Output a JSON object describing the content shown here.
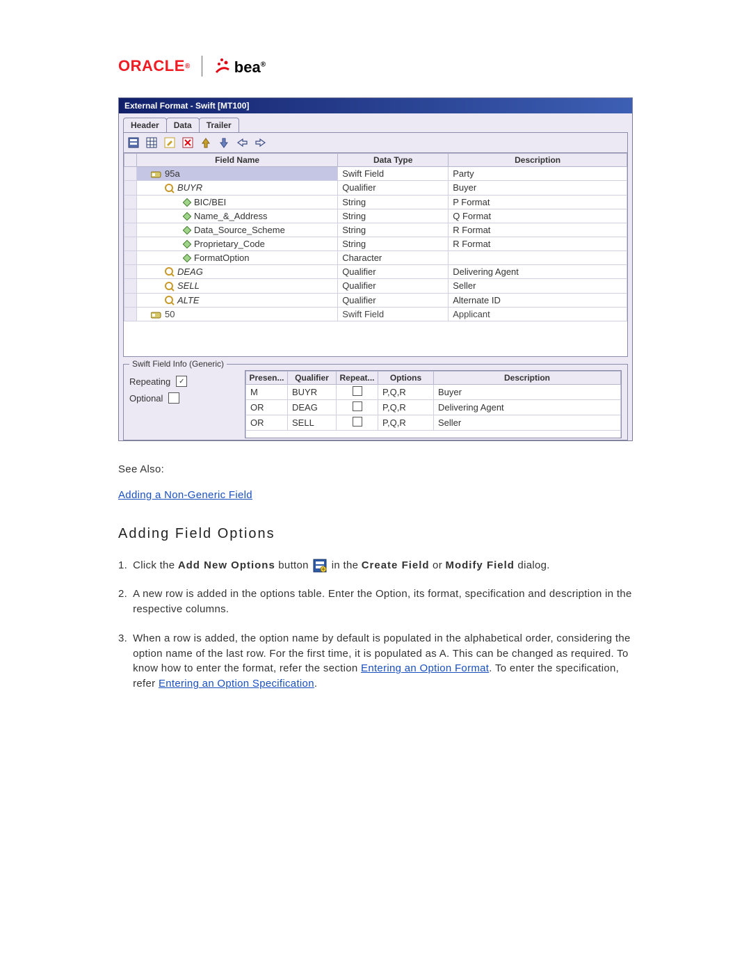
{
  "brand": {
    "oracle": "ORACLE",
    "bea": "bea"
  },
  "window": {
    "title": "External Format - Swift [MT100]"
  },
  "tabs": [
    "Header",
    "Data",
    "Trailer"
  ],
  "grid": {
    "headers": [
      "Field Name",
      "Data Type",
      "Description"
    ],
    "rows": [
      {
        "indent": 0,
        "icon": "qual",
        "name": "95a",
        "type": "Swift Field",
        "desc": "Party",
        "selected": true
      },
      {
        "indent": 1,
        "icon": "q",
        "style": "italic",
        "name": "BUYR",
        "type": "Qualifier",
        "desc": "Buyer"
      },
      {
        "indent": 2,
        "icon": "d",
        "name": "BIC/BEI",
        "type": "String",
        "desc": "P Format"
      },
      {
        "indent": 2,
        "icon": "d",
        "name": "Name_&_Address",
        "type": "String",
        "desc": "Q Format"
      },
      {
        "indent": 2,
        "icon": "d",
        "name": "Data_Source_Scheme",
        "type": "String",
        "desc": "R Format"
      },
      {
        "indent": 2,
        "icon": "d",
        "name": "Proprietary_Code",
        "type": "String",
        "desc": "R Format"
      },
      {
        "indent": 2,
        "icon": "d",
        "name": "FormatOption",
        "type": "Character",
        "desc": ""
      },
      {
        "indent": 1,
        "icon": "q",
        "style": "italic",
        "name": "DEAG",
        "type": "Qualifier",
        "desc": "Delivering Agent"
      },
      {
        "indent": 1,
        "icon": "q",
        "style": "italic",
        "name": "SELL",
        "type": "Qualifier",
        "desc": "Seller"
      },
      {
        "indent": 1,
        "icon": "q",
        "style": "italic",
        "name": "ALTE",
        "type": "Qualifier",
        "desc": "Alternate ID"
      },
      {
        "indent": 0,
        "icon": "qual",
        "name": "50",
        "type": "Swift Field",
        "desc": "Applicant",
        "partial": true
      }
    ]
  },
  "info": {
    "legend": "Swift Field Info (Generic)",
    "repeating_label": "Repeating",
    "optional_label": "Optional",
    "repeating_checked": true,
    "optional_checked": false,
    "headers": [
      "Presen...",
      "Qualifier",
      "Repeat...",
      "Options",
      "Description"
    ],
    "rows": [
      {
        "p": "M",
        "q": "BUYR",
        "r": false,
        "o": "P,Q,R",
        "d": "Buyer"
      },
      {
        "p": "OR",
        "q": "DEAG",
        "r": false,
        "o": "P,Q,R",
        "d": "Delivering Agent"
      },
      {
        "p": "OR",
        "q": "SELL",
        "r": false,
        "o": "P,Q,R",
        "d": "Seller"
      }
    ]
  },
  "doc": {
    "see_also": "See Also:",
    "link_nongeneric": "Adding a Non-Generic Field",
    "heading": "Adding Field Options",
    "step1a": "Click the ",
    "step1b": "Add New Options",
    "step1c": " button ",
    "step1d": " in the ",
    "step1e": "Create Field",
    "step1f": " or ",
    "step1g": "Modify Field",
    "step1h": " dialog.",
    "step2": "A new row is added in the options table. Enter the Option, its format, specification and description in the respective columns.",
    "step3a": "When a row is added, the option name by default is populated in the alphabetical order, considering the option name of the last row. For the first time, it is populated as A. This can be changed as required. To know how to enter the format, refer the section ",
    "link_optfmt": "Entering an Option Format",
    "step3b": ". To enter the specification, refer ",
    "link_optspec": "Entering an Option Specification",
    "step3c": "."
  }
}
